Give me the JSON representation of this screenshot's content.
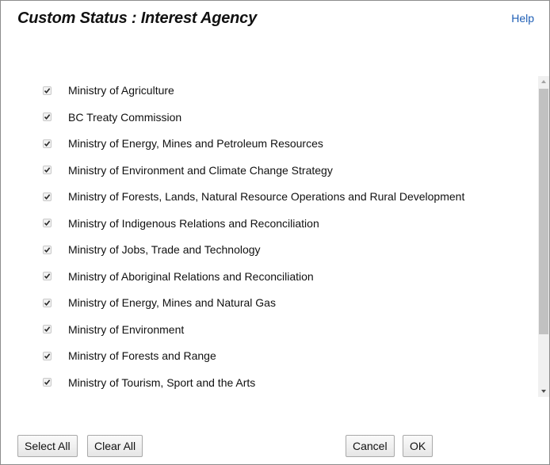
{
  "dialog": {
    "title": "Custom Status :  Interest Agency",
    "help_label": "Help"
  },
  "agencies": [
    {
      "label": "Ministry of Agriculture",
      "checked": true
    },
    {
      "label": "BC Treaty Commission",
      "checked": true
    },
    {
      "label": "Ministry of Energy, Mines and Petroleum Resources",
      "checked": true
    },
    {
      "label": "Ministry of Environment and Climate Change Strategy",
      "checked": true
    },
    {
      "label": "Ministry of Forests, Lands, Natural Resource Operations and Rural Development",
      "checked": true
    },
    {
      "label": "Ministry of Indigenous Relations and Reconciliation",
      "checked": true
    },
    {
      "label": "Ministry of Jobs, Trade and Technology",
      "checked": true
    },
    {
      "label": "Ministry of Aboriginal Relations and Reconciliation",
      "checked": true
    },
    {
      "label": "Ministry of Energy, Mines and Natural Gas",
      "checked": true
    },
    {
      "label": "Ministry of Environment",
      "checked": true
    },
    {
      "label": "Ministry of Forests and Range",
      "checked": true
    },
    {
      "label": "Ministry of Tourism, Sport and the Arts",
      "checked": true
    }
  ],
  "buttons": {
    "select_all": "Select All",
    "clear_all": "Clear All",
    "cancel": "Cancel",
    "ok": "OK"
  },
  "colors": {
    "link": "#1f5fb6",
    "scroll_thumb": "#c1c1c1"
  }
}
